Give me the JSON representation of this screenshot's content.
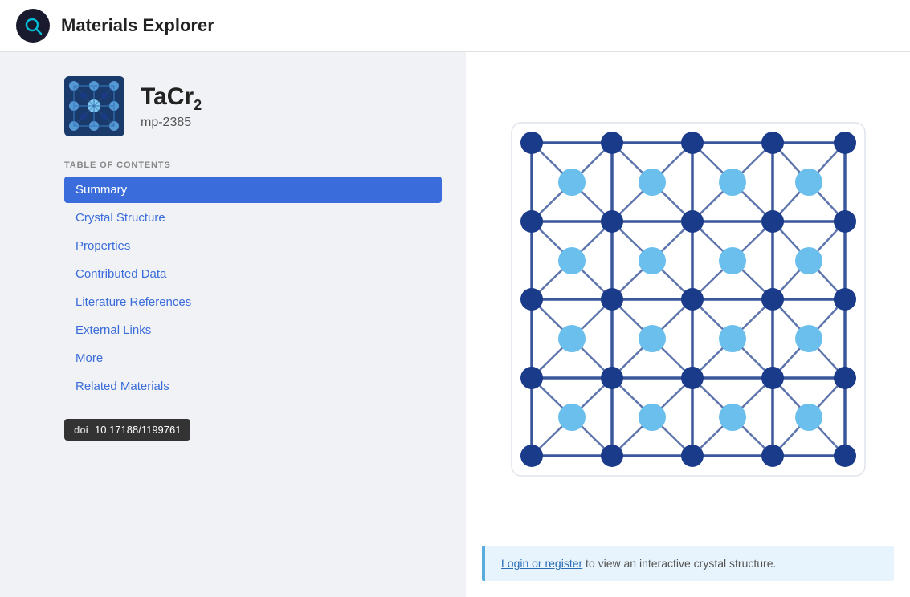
{
  "header": {
    "logo_icon": "search-icon",
    "title": "Materials Explorer"
  },
  "material": {
    "formula_base": "TaCr",
    "formula_subscript": "2",
    "id": "mp-2385",
    "thumbnail_alt": "TaCr2 crystal thumbnail"
  },
  "toc": {
    "label": "TABLE OF CONTENTS",
    "items": [
      {
        "id": "summary",
        "label": "Summary",
        "active": true
      },
      {
        "id": "crystal-structure",
        "label": "Crystal Structure",
        "active": false
      },
      {
        "id": "properties",
        "label": "Properties",
        "active": false
      },
      {
        "id": "contributed-data",
        "label": "Contributed Data",
        "active": false
      },
      {
        "id": "literature-references",
        "label": "Literature References",
        "active": false
      },
      {
        "id": "external-links",
        "label": "External Links",
        "active": false
      },
      {
        "id": "more",
        "label": "More",
        "active": false
      },
      {
        "id": "related-materials",
        "label": "Related Materials",
        "active": false
      }
    ]
  },
  "doi": {
    "label": "doi",
    "value": "10.17188/1199761"
  },
  "crystal_notice": {
    "link_text": "Login or register",
    "rest_text": " to view an interactive crystal structure."
  }
}
